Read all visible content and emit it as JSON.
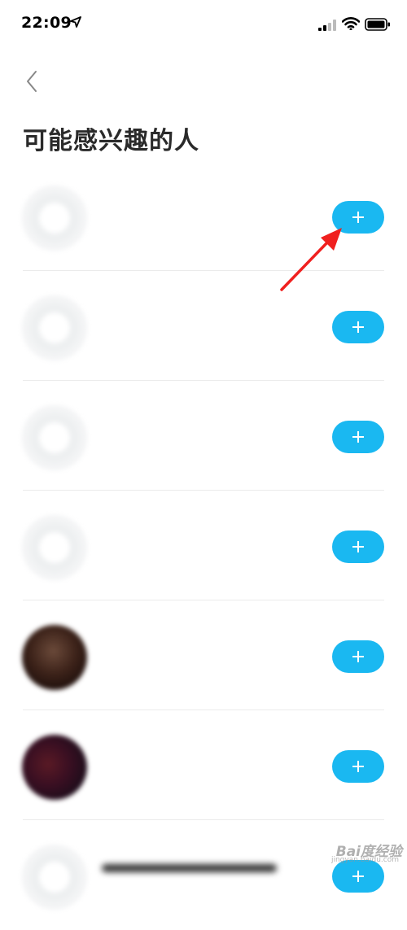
{
  "status_bar": {
    "time": "22:09",
    "icons": [
      "location-arrow-icon",
      "signal-icon",
      "wifi-icon",
      "battery-icon"
    ]
  },
  "nav": {
    "back_icon": "chevron-left-icon"
  },
  "page": {
    "title": "可能感兴趣的人"
  },
  "suggestions": [
    {
      "name": "",
      "avatar": "blank",
      "button": "+"
    },
    {
      "name": "",
      "avatar": "blank",
      "button": "+"
    },
    {
      "name": "",
      "avatar": "blank",
      "button": "+"
    },
    {
      "name": "",
      "avatar": "blank",
      "button": "+"
    },
    {
      "name": "",
      "avatar": "photo1",
      "button": "+"
    },
    {
      "name": "",
      "avatar": "photo2",
      "button": "+"
    },
    {
      "name": "",
      "avatar": "blank",
      "button": "+"
    }
  ],
  "annotation": {
    "arrow_icon": "red-arrow-icon"
  },
  "watermark": {
    "text": "Bai度经验",
    "sub": "jingyan.baidu.com"
  },
  "colors": {
    "accent": "#1ab8f1",
    "arrow": "#f0201f",
    "divider": "#ebebeb"
  }
}
